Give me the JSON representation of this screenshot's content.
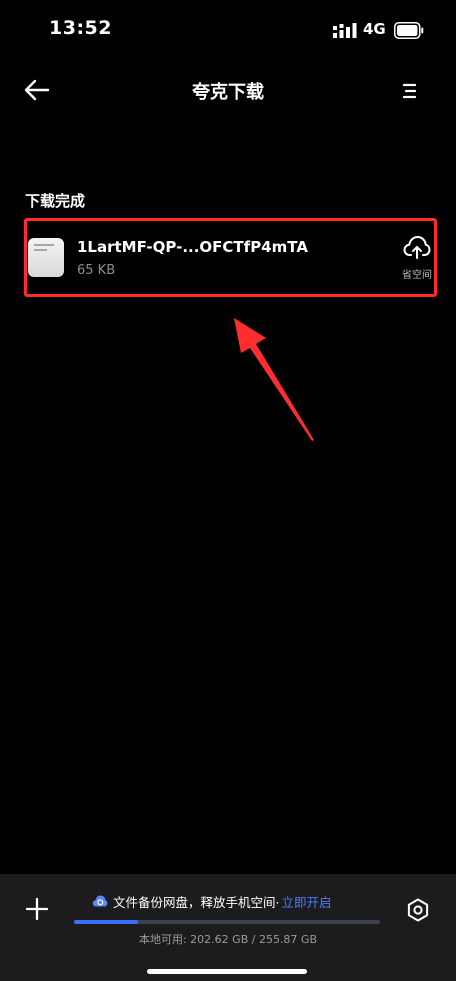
{
  "status_bar": {
    "time": "13:52",
    "network": "4G"
  },
  "nav": {
    "title": "夸克下载",
    "back_icon": "arrow-left-icon",
    "menu_icon": "menu-icon"
  },
  "section": {
    "title": "下载完成"
  },
  "downloads": [
    {
      "name": "1LartMF-QP-...OFCTfP4mTA",
      "size": "65 KB",
      "action_label": "省空间",
      "action_icon": "cloud-upload-icon"
    }
  ],
  "bottom_bar": {
    "promo_text": "文件备份网盘，释放手机空间·",
    "promo_link": "立即开启",
    "storage_text": "本地可用: 202.62 GB / 255.87 GB",
    "storage_used_fraction": 0.21,
    "add_icon": "plus-icon",
    "settings_icon": "settings-icon"
  },
  "colors": {
    "background": "#000000",
    "highlight_border": "#ff2d2d",
    "accent_link": "#4e7bff",
    "progress_fill": "#3b6dff",
    "bottom_bar_bg": "#1c1c1e"
  }
}
